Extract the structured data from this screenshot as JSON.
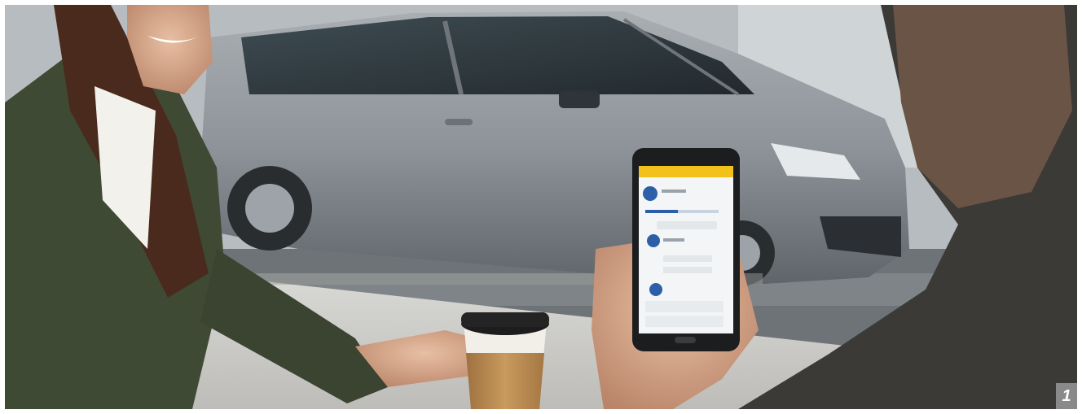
{
  "photo": {
    "subject": "car-app-lifestyle-photo"
  },
  "phone": {
    "header_title": "",
    "rows": [
      "",
      "",
      ""
    ]
  },
  "badge": {
    "number": "1"
  },
  "colors": {
    "car_body": "#8f969c",
    "phone_header": "#f2c21b",
    "coffee_sleeve": "#b98a4e",
    "jacket": "#3f4a35",
    "badge_bg": "#8a8a8a"
  }
}
